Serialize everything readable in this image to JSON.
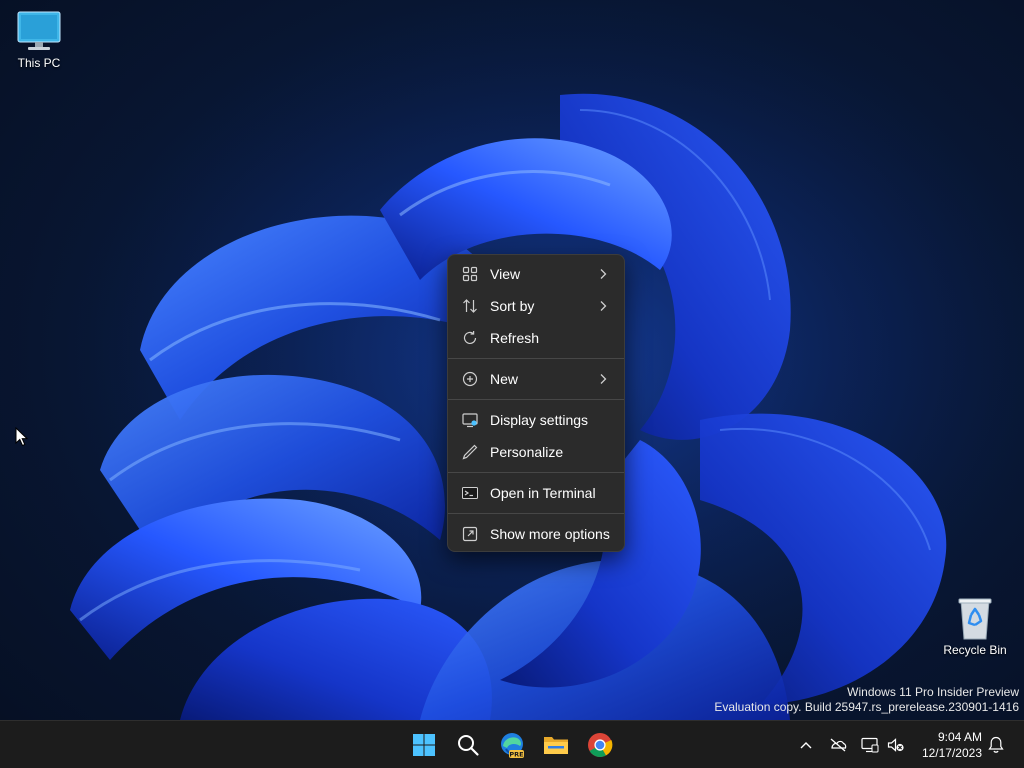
{
  "desktop": {
    "icons": [
      {
        "label": "This PC",
        "icon": "computer-icon"
      },
      {
        "label": "Recycle Bin",
        "icon": "recycle-bin-icon"
      }
    ],
    "watermark": {
      "line1": "Windows 11 Pro Insider Preview",
      "line2": "Evaluation copy. Build 25947.rs_prerelease.230901-1416"
    }
  },
  "context_menu": {
    "items": [
      {
        "label": "View",
        "icon": "grid-icon",
        "submenu": true
      },
      {
        "label": "Sort by",
        "icon": "sort-icon",
        "submenu": true
      },
      {
        "label": "Refresh",
        "icon": "refresh-icon",
        "submenu": false
      },
      {
        "label": "New",
        "icon": "plus-circle-icon",
        "submenu": true
      },
      {
        "label": "Display settings",
        "icon": "display-icon",
        "submenu": false
      },
      {
        "label": "Personalize",
        "icon": "pen-icon",
        "submenu": false
      },
      {
        "label": "Open in Terminal",
        "icon": "terminal-icon",
        "submenu": false
      },
      {
        "label": "Show more options",
        "icon": "more-options-icon",
        "submenu": false
      }
    ]
  },
  "taskbar": {
    "apps": [
      {
        "name": "start",
        "icon": "windows-logo-icon"
      },
      {
        "name": "search",
        "icon": "search-icon"
      },
      {
        "name": "edge-preview",
        "icon": "edge-pre-icon",
        "badge": "PRE"
      },
      {
        "name": "file-explorer",
        "icon": "folder-icon"
      },
      {
        "name": "chrome",
        "icon": "chrome-icon"
      }
    ],
    "tray": {
      "icons": [
        "chevron-up-icon",
        "network-off-icon",
        "display-monitor-icon",
        "volume-muted-icon"
      ],
      "time": "9:04 AM",
      "date": "12/17/2023",
      "notification_icon": "bell-icon"
    }
  },
  "colors": {
    "menu_bg": "#2b2b2b",
    "taskbar_bg": "#1c1c1c",
    "accent_blue": "#1f5cff",
    "windows_logo": "#4cc2ff"
  }
}
